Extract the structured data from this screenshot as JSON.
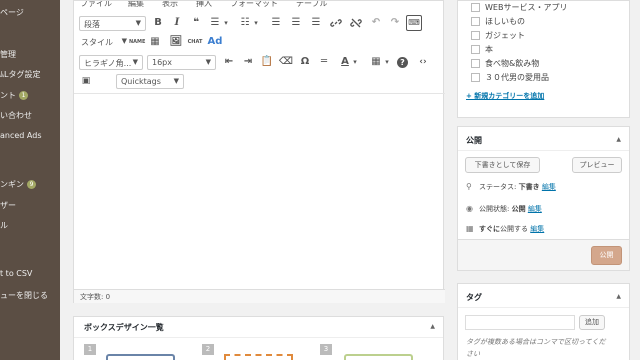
{
  "sidebar": {
    "items": [
      {
        "label": "ページ"
      },
      {
        "label": "管理"
      },
      {
        "label": "ﾑLタグ設定"
      },
      {
        "label": "ント",
        "badge": "1"
      },
      {
        "label": "い合わせ"
      },
      {
        "label": "anced Ads"
      },
      {
        "label": "ンギン",
        "badge": "9"
      },
      {
        "label": "ザー"
      },
      {
        "label": "ル"
      },
      {
        "label": "t to CSV"
      },
      {
        "label": "ューを閉じる"
      }
    ]
  },
  "editor": {
    "menu": [
      "ファイル",
      "編集",
      "表示",
      "挿入",
      "フォーマット",
      "テーブル"
    ],
    "format_select": "段落",
    "style_select": "スタイル",
    "font_select": "ヒラギノ角...",
    "size_select": "16px",
    "quicktags_select": "Quicktags",
    "icons": {
      "bold": "B",
      "italic": "I",
      "quote": "❝",
      "ul": "☰",
      "ol": "☷",
      "al": "☰",
      "ac": "☰",
      "ar": "☰",
      "link": "🔗",
      "unlink": "⛓",
      "undo": "↶",
      "redo": "↷",
      "clear": "⌨",
      "name": "NAME",
      "table": "▦",
      "image": "🖼",
      "chat": "CHAT",
      "ad": "Ad",
      "indent": "⇤",
      "outdent": "⇥",
      "paste": "📋",
      "eraser": "⌫",
      "omega": "Ω",
      "hr": "═",
      "color": "A",
      "tbl": "▦",
      "help": "?",
      "code": "‹›",
      "media": "▣"
    },
    "word_count": "文字数: 0"
  },
  "box_panel": {
    "title": "ボックスデザイン一覧",
    "nums": [
      "1",
      "2",
      "3"
    ]
  },
  "categories": {
    "items": [
      "WEBサービス・アプリ",
      "ほしいもの",
      "ガジェット",
      "本",
      "食べ物&飲み物",
      "３０代男の愛用品"
    ],
    "add_link": "+ 新規カテゴリーを追加"
  },
  "publish": {
    "title": "公開",
    "save_draft": "下書きとして保存",
    "preview": "プレビュー",
    "status_label": "ステータス: ",
    "status_value": "下書き",
    "edit": "編集",
    "visibility_label": "公開状態: ",
    "visibility_value": "公開",
    "schedule_label": "すぐに",
    "schedule_suffix": "公開する",
    "publish_button": "公開"
  },
  "tags": {
    "title": "タグ",
    "add": "追加",
    "help1": "タグが複数ある場合はコンマで区切ってくだ",
    "help2": "さい"
  },
  "colors": {
    "sidebar": "#5b4e44",
    "publish_btn": "#d4a78c",
    "link": "#0073aa"
  }
}
